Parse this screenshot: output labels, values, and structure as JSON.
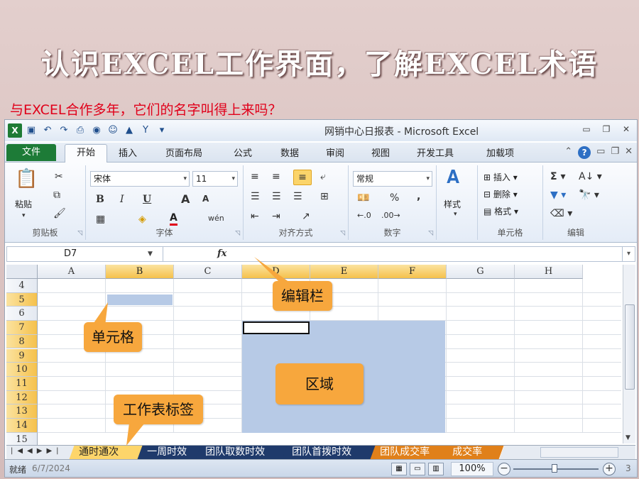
{
  "slide": {
    "title": "认识EXCEL工作界面，了解EXCEL术语",
    "subtitle": "与EXCEL合作多年，它们的名字叫得上来吗？"
  },
  "window": {
    "title": "网销中心日报表 - Microsoft Excel"
  },
  "tabs": [
    {
      "label": "文件"
    },
    {
      "label": "开始"
    },
    {
      "label": "插入"
    },
    {
      "label": "页面布局"
    },
    {
      "label": "公式"
    },
    {
      "label": "数据"
    },
    {
      "label": "审阅"
    },
    {
      "label": "视图"
    },
    {
      "label": "开发工具"
    },
    {
      "label": "加载项"
    }
  ],
  "ribbon": {
    "clipboard": {
      "group_label": "剪贴板",
      "paste_label": "粘贴"
    },
    "font": {
      "group_label": "字体",
      "font_name": "宋体",
      "font_size": "11",
      "bold": "B",
      "italic": "I",
      "underline": "U",
      "grow": "A",
      "shrink": "A",
      "color_a": "A",
      "phonetic": "wén"
    },
    "alignment": {
      "group_label": "对齐方式"
    },
    "number": {
      "group_label": "数字",
      "format": "常规",
      "percent": "%",
      "comma": ","
    },
    "styles": {
      "group_label": "样式",
      "styles_label": "样式"
    },
    "cells": {
      "group_label": "单元格",
      "insert": "插入",
      "delete": "删除",
      "format": "格式"
    },
    "editing": {
      "group_label": "编辑"
    }
  },
  "formula_bar": {
    "name_box": "D7",
    "fx": "fx"
  },
  "grid": {
    "columns": [
      "A",
      "B",
      "C",
      "D",
      "E",
      "F",
      "G",
      "H"
    ],
    "selected_columns": [
      "B",
      "D",
      "E",
      "F"
    ],
    "rows": [
      "4",
      "5",
      "6",
      "7",
      "8",
      "9",
      "10",
      "11",
      "12",
      "13",
      "14",
      "15"
    ],
    "selected_rows": [
      "5",
      "7",
      "8",
      "9",
      "10",
      "11",
      "12",
      "13",
      "14"
    ]
  },
  "sheet_tabs": [
    {
      "label": "通时通次",
      "state": "active"
    },
    {
      "label": "一周时效",
      "state": "normal"
    },
    {
      "label": "团队取数时效",
      "state": "normal"
    },
    {
      "label": "团队首拨时效",
      "state": "normal"
    },
    {
      "label": "团队成交率",
      "state": "orange"
    },
    {
      "label": "成交率",
      "state": "orange"
    }
  ],
  "status_bar": {
    "status": "就绪",
    "overlay_text": "6/7/2024",
    "zoom": "100%",
    "page_number": "3"
  },
  "callouts": {
    "formula_bar": "编辑栏",
    "cell": "单元格",
    "range": "区域",
    "sheet_tab": "工作表标签"
  },
  "colors": {
    "range_fill": "#b7cae6",
    "callout": "#f7a73d",
    "subtitle": "#e0001a",
    "file_tab": "#1d7b37"
  }
}
